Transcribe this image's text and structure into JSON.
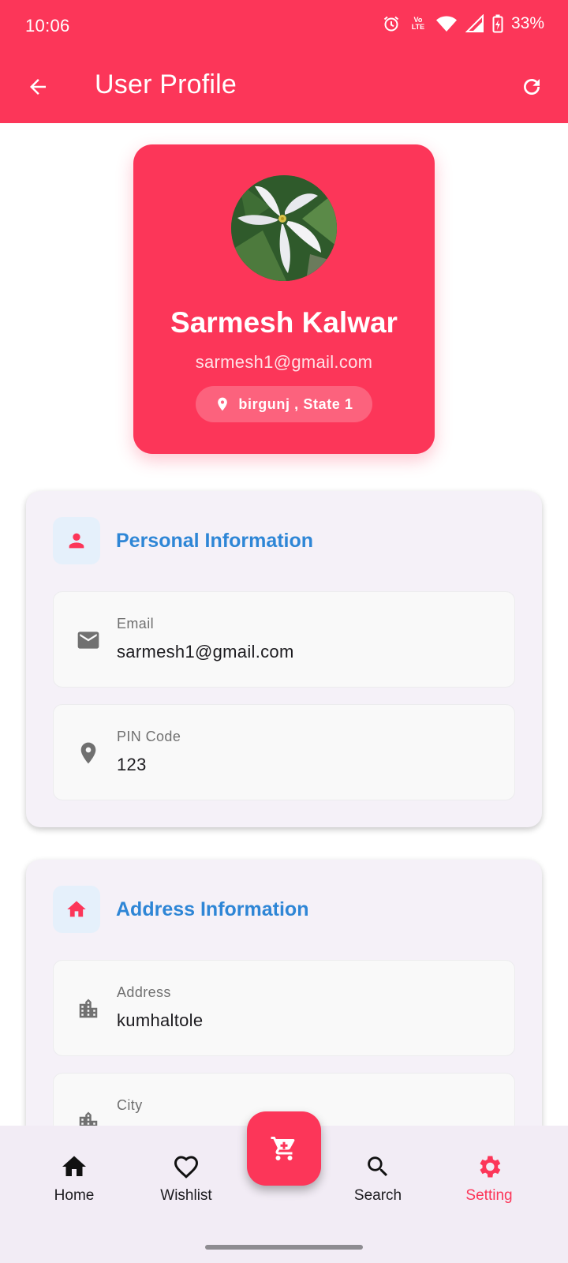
{
  "status_bar": {
    "time": "10:06",
    "network_badge_top": "Vo",
    "network_badge_bottom": "LTE",
    "battery": "33%"
  },
  "app_bar": {
    "title": "User Profile",
    "back_icon": "arrow-back-icon",
    "refresh_icon": "refresh-icon"
  },
  "profile": {
    "name": "Sarmesh Kalwar",
    "email": "sarmesh1@gmail.com",
    "location": "birgunj , State 1"
  },
  "personal_section": {
    "title": "Personal Information",
    "fields": [
      {
        "label": "Email",
        "value": "sarmesh1@gmail.com",
        "icon": "mail-icon"
      },
      {
        "label": "PIN Code",
        "value": "123",
        "icon": "location-pin-icon"
      }
    ]
  },
  "address_section": {
    "title": "Address Information",
    "fields": [
      {
        "label": "Address",
        "value": "kumhaltole",
        "icon": "building-icon"
      },
      {
        "label": "City",
        "value": "",
        "icon": "building-icon"
      }
    ]
  },
  "bottom_nav": {
    "items": [
      {
        "label": "Home",
        "icon": "home-icon"
      },
      {
        "label": "Wishlist",
        "icon": "heart-icon"
      },
      {
        "label": "Search",
        "icon": "search-icon"
      },
      {
        "label": "Setting",
        "icon": "gear-icon",
        "active": true
      }
    ],
    "fab_icon": "cart-icon"
  },
  "colors": {
    "primary": "#fc3659",
    "section_title": "#2e86d6",
    "section_bg": "#f5f1f8",
    "nav_bg": "#f2ecf5"
  }
}
